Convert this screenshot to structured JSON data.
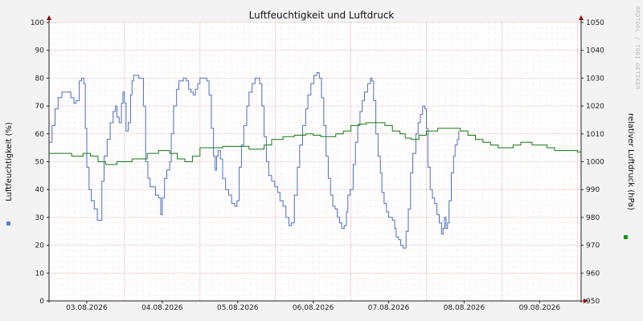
{
  "chart_data": {
    "type": "line",
    "title": "Luftfeuchtigkeit und Luftdruck",
    "ylabel": "Luftfeuchtigkeit (%)",
    "y2label": "relativer Luftdruck (hPa)",
    "watermark": "RRDTOOL / TOBI OETIKER",
    "ylim": [
      0,
      100
    ],
    "y2lim": [
      950,
      1050
    ],
    "yticks": [
      0,
      10,
      20,
      30,
      40,
      50,
      60,
      70,
      80,
      90,
      100
    ],
    "y2ticks": [
      950,
      960,
      970,
      980,
      990,
      1000,
      1010,
      1020,
      1030,
      1040,
      1050
    ],
    "xlim": [
      0,
      7.05
    ],
    "xticks": [
      {
        "pos": 0.5,
        "label": "03.08.2026"
      },
      {
        "pos": 1.5,
        "label": "04.08.2026"
      },
      {
        "pos": 2.5,
        "label": "05.08.2026"
      },
      {
        "pos": 3.5,
        "label": "06.08.2026"
      },
      {
        "pos": 4.5,
        "label": "07.08.2026"
      },
      {
        "pos": 5.5,
        "label": "08.08.2026"
      },
      {
        "pos": 6.5,
        "label": "09.08.2026"
      }
    ],
    "day_boundaries": [
      1,
      2,
      3,
      4,
      5,
      6,
      7
    ],
    "grid": true,
    "colors": {
      "humidity": "#4a6fbf",
      "pressure": "#117711",
      "grid": "#e4a9a9",
      "arrow": "#990000",
      "axis": "#222222",
      "humidity_marker": "#5b7fdf",
      "pressure_marker": "#119911"
    },
    "series": [
      {
        "axis": "left",
        "points": [
          [
            0.0,
            57
          ],
          [
            0.04,
            63
          ],
          [
            0.08,
            69
          ],
          [
            0.12,
            73
          ],
          [
            0.17,
            75
          ],
          [
            0.25,
            75
          ],
          [
            0.29,
            73
          ],
          [
            0.33,
            71
          ],
          [
            0.36,
            72
          ],
          [
            0.4,
            79
          ],
          [
            0.43,
            80
          ],
          [
            0.46,
            78
          ],
          [
            0.48,
            62
          ],
          [
            0.5,
            48
          ],
          [
            0.53,
            40
          ],
          [
            0.56,
            36
          ],
          [
            0.6,
            33
          ],
          [
            0.64,
            29
          ],
          [
            0.67,
            29
          ],
          [
            0.7,
            43
          ],
          [
            0.73,
            52
          ],
          [
            0.77,
            58
          ],
          [
            0.81,
            64
          ],
          [
            0.85,
            68
          ],
          [
            0.88,
            70
          ],
          [
            0.9,
            66
          ],
          [
            0.93,
            64
          ],
          [
            0.96,
            71
          ],
          [
            0.98,
            75
          ],
          [
            1.0,
            71
          ],
          [
            1.02,
            61
          ],
          [
            1.05,
            64
          ],
          [
            1.08,
            74
          ],
          [
            1.1,
            79
          ],
          [
            1.12,
            81
          ],
          [
            1.19,
            80
          ],
          [
            1.23,
            80
          ],
          [
            1.25,
            70
          ],
          [
            1.28,
            50
          ],
          [
            1.31,
            44
          ],
          [
            1.34,
            41
          ],
          [
            1.37,
            41
          ],
          [
            1.41,
            38
          ],
          [
            1.45,
            37
          ],
          [
            1.48,
            31
          ],
          [
            1.5,
            37
          ],
          [
            1.53,
            44
          ],
          [
            1.56,
            47
          ],
          [
            1.6,
            50
          ],
          [
            1.62,
            60
          ],
          [
            1.65,
            70
          ],
          [
            1.69,
            76
          ],
          [
            1.72,
            79
          ],
          [
            1.78,
            80
          ],
          [
            1.82,
            79
          ],
          [
            1.85,
            76
          ],
          [
            1.88,
            75
          ],
          [
            1.91,
            74
          ],
          [
            1.94,
            76
          ],
          [
            1.97,
            78
          ],
          [
            2.0,
            80
          ],
          [
            2.06,
            80
          ],
          [
            2.09,
            79
          ],
          [
            2.12,
            74
          ],
          [
            2.15,
            62
          ],
          [
            2.18,
            52
          ],
          [
            2.2,
            47
          ],
          [
            2.22,
            52
          ],
          [
            2.24,
            54
          ],
          [
            2.27,
            51
          ],
          [
            2.3,
            44
          ],
          [
            2.34,
            40
          ],
          [
            2.38,
            38
          ],
          [
            2.42,
            35
          ],
          [
            2.46,
            34
          ],
          [
            2.49,
            36
          ],
          [
            2.52,
            48
          ],
          [
            2.55,
            56
          ],
          [
            2.58,
            63
          ],
          [
            2.62,
            70
          ],
          [
            2.65,
            75
          ],
          [
            2.69,
            78
          ],
          [
            2.73,
            80
          ],
          [
            2.76,
            80
          ],
          [
            2.79,
            78
          ],
          [
            2.82,
            70
          ],
          [
            2.85,
            59
          ],
          [
            2.88,
            50
          ],
          [
            2.91,
            45
          ],
          [
            2.95,
            43
          ],
          [
            2.99,
            41
          ],
          [
            3.03,
            39
          ],
          [
            3.06,
            36
          ],
          [
            3.1,
            34
          ],
          [
            3.14,
            30
          ],
          [
            3.18,
            27
          ],
          [
            3.21,
            28
          ],
          [
            3.25,
            38
          ],
          [
            3.29,
            48
          ],
          [
            3.32,
            56
          ],
          [
            3.36,
            63
          ],
          [
            3.4,
            69
          ],
          [
            3.43,
            74
          ],
          [
            3.47,
            78
          ],
          [
            3.51,
            81
          ],
          [
            3.55,
            82
          ],
          [
            3.58,
            80
          ],
          [
            3.61,
            73
          ],
          [
            3.64,
            63
          ],
          [
            3.67,
            52
          ],
          [
            3.7,
            44
          ],
          [
            3.73,
            38
          ],
          [
            3.76,
            34
          ],
          [
            3.79,
            33
          ],
          [
            3.82,
            30
          ],
          [
            3.85,
            28
          ],
          [
            3.88,
            26
          ],
          [
            3.91,
            27
          ],
          [
            3.94,
            32
          ],
          [
            3.96,
            38
          ],
          [
            3.99,
            40
          ],
          [
            4.03,
            49
          ],
          [
            4.06,
            57
          ],
          [
            4.09,
            63
          ],
          [
            4.12,
            68
          ],
          [
            4.15,
            72
          ],
          [
            4.18,
            75
          ],
          [
            4.22,
            78
          ],
          [
            4.26,
            80
          ],
          [
            4.28,
            79
          ],
          [
            4.3,
            72
          ],
          [
            4.33,
            60
          ],
          [
            4.36,
            52
          ],
          [
            4.39,
            46
          ],
          [
            4.41,
            39
          ],
          [
            4.44,
            35
          ],
          [
            4.47,
            32
          ],
          [
            4.5,
            30
          ],
          [
            4.52,
            30
          ],
          [
            4.55,
            29
          ],
          [
            4.58,
            26
          ],
          [
            4.6,
            23
          ],
          [
            4.63,
            22
          ],
          [
            4.66,
            20
          ],
          [
            4.69,
            19
          ],
          [
            4.71,
            19
          ],
          [
            4.73,
            25
          ],
          [
            4.76,
            33
          ],
          [
            4.79,
            46
          ],
          [
            4.82,
            53
          ],
          [
            4.86,
            60
          ],
          [
            4.89,
            64
          ],
          [
            4.92,
            67
          ],
          [
            4.95,
            70
          ],
          [
            4.98,
            69
          ],
          [
            5.0,
            62
          ],
          [
            5.02,
            48
          ],
          [
            5.05,
            40
          ],
          [
            5.08,
            37
          ],
          [
            5.11,
            35
          ],
          [
            5.14,
            31
          ],
          [
            5.17,
            28
          ],
          [
            5.2,
            24
          ],
          [
            5.22,
            26
          ],
          [
            5.24,
            30
          ],
          [
            5.26,
            26
          ],
          [
            5.28,
            28
          ],
          [
            5.3,
            36
          ],
          [
            5.33,
            46
          ],
          [
            5.36,
            52
          ],
          [
            5.38,
            56
          ],
          [
            5.41,
            58
          ],
          [
            5.43,
            61
          ]
        ],
        "_note": "humidity in % (hourly-ish steps, 7 days); x = day offset from 03.08.2026 00:00"
      },
      {
        "axis": "right",
        "points": [
          [
            0.0,
            1003
          ],
          [
            0.3,
            1002
          ],
          [
            0.45,
            1003
          ],
          [
            0.55,
            1002
          ],
          [
            0.65,
            1000
          ],
          [
            0.75,
            999
          ],
          [
            0.9,
            1000
          ],
          [
            1.1,
            1001
          ],
          [
            1.3,
            1003
          ],
          [
            1.45,
            1004
          ],
          [
            1.6,
            1003
          ],
          [
            1.7,
            1001
          ],
          [
            1.8,
            1000
          ],
          [
            1.9,
            1002
          ],
          [
            2.0,
            1005
          ],
          [
            2.1,
            1005
          ],
          [
            2.3,
            1005.5
          ],
          [
            2.5,
            1005.5
          ],
          [
            2.65,
            1004.5
          ],
          [
            2.75,
            1004.5
          ],
          [
            2.85,
            1006
          ],
          [
            2.95,
            1008
          ],
          [
            3.1,
            1009
          ],
          [
            3.25,
            1009.5
          ],
          [
            3.4,
            1010
          ],
          [
            3.5,
            1009.5
          ],
          [
            3.6,
            1009
          ],
          [
            3.7,
            1009
          ],
          [
            3.8,
            1010
          ],
          [
            3.9,
            1011
          ],
          [
            4.0,
            1013
          ],
          [
            4.1,
            1013.5
          ],
          [
            4.2,
            1014
          ],
          [
            4.35,
            1014
          ],
          [
            4.45,
            1013
          ],
          [
            4.55,
            1011
          ],
          [
            4.65,
            1010
          ],
          [
            4.72,
            1008.5
          ],
          [
            4.8,
            1008
          ],
          [
            4.9,
            1009.5
          ],
          [
            5.0,
            1011
          ],
          [
            5.15,
            1012
          ],
          [
            5.3,
            1012
          ],
          [
            5.45,
            1011
          ],
          [
            5.55,
            1009.5
          ],
          [
            5.65,
            1008
          ],
          [
            5.75,
            1007
          ],
          [
            5.85,
            1006
          ],
          [
            5.95,
            1005
          ],
          [
            6.05,
            1005
          ],
          [
            6.15,
            1006
          ],
          [
            6.25,
            1007
          ],
          [
            6.4,
            1006
          ],
          [
            6.5,
            1006
          ],
          [
            6.6,
            1005
          ],
          [
            6.7,
            1004
          ],
          [
            6.8,
            1004
          ],
          [
            6.9,
            1004
          ],
          [
            7.0,
            1003.5
          ],
          [
            7.05,
            1003
          ]
        ]
      }
    ]
  }
}
